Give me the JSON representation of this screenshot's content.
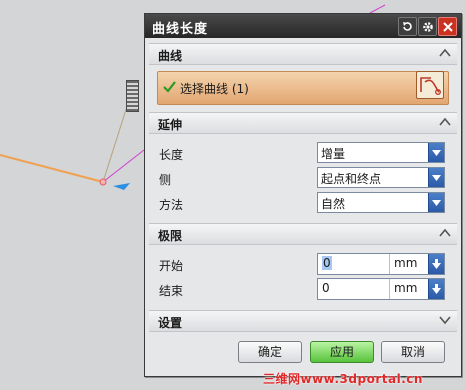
{
  "dialog": {
    "title": "曲线长度",
    "sections": {
      "curve": "曲线",
      "extend": "延伸",
      "limits": "极限",
      "settings": "设置"
    },
    "select_curve": "选择曲线 (1)",
    "fields": {
      "length_label": "长度",
      "length_value": "增量",
      "side_label": "侧",
      "side_value": "起点和终点",
      "method_label": "方法",
      "method_value": "自然",
      "start_label": "开始",
      "start_value": "0",
      "start_unit": "mm",
      "end_label": "结束",
      "end_value": "0",
      "end_unit": "mm"
    },
    "buttons": {
      "ok": "确定",
      "apply": "应用",
      "cancel": "取消"
    }
  },
  "watermark": "三维网www.3dportal.cn",
  "colors": {
    "titlebar": "#2e2e2e",
    "selection_highlight": "#e8b07c",
    "apply_green": "#62c94a",
    "combo_arrow_blue": "#2f63b3",
    "curve_orange": "#f0a050",
    "watermark_red": "#e02828"
  }
}
